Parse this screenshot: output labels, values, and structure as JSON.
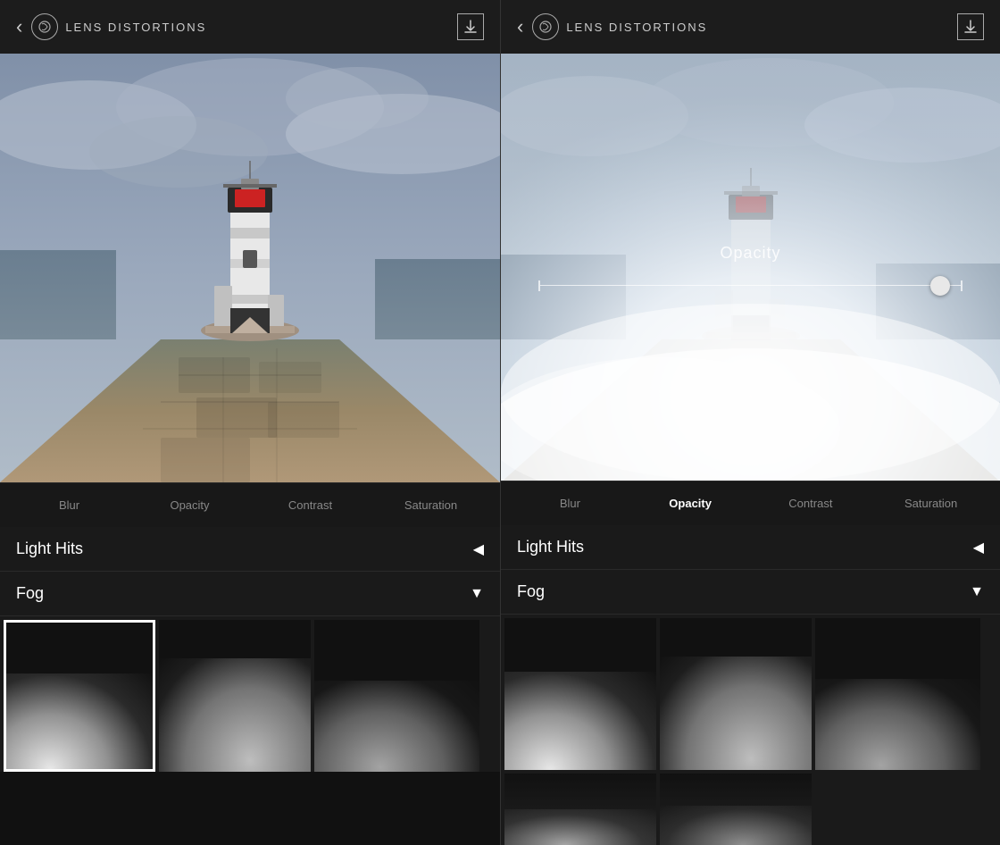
{
  "left_panel": {
    "header": {
      "back_label": "‹",
      "logo_icon": "◎",
      "logo_text": "LENS DISTORTIONS",
      "download_icon": "⬇"
    },
    "controls": [
      {
        "label": "Blur",
        "active": false
      },
      {
        "label": "Opacity",
        "active": false
      },
      {
        "label": "Contrast",
        "active": false
      },
      {
        "label": "Saturation",
        "active": false
      }
    ],
    "sections": [
      {
        "title": "Light Hits",
        "arrow": "◀",
        "type": "collapse"
      },
      {
        "title": "Fog",
        "arrow": "▼",
        "type": "expand"
      }
    ]
  },
  "right_panel": {
    "header": {
      "back_label": "‹",
      "logo_icon": "◎",
      "logo_text": "LENS DISTORTIONS",
      "download_icon": "⬇"
    },
    "opacity_label": "Opacity",
    "controls": [
      {
        "label": "Blur",
        "active": false
      },
      {
        "label": "Opacity",
        "active": true
      },
      {
        "label": "Contrast",
        "active": false
      },
      {
        "label": "Saturation",
        "active": false
      }
    ],
    "sections": [
      {
        "title": "Light Hits",
        "arrow": "◀",
        "type": "collapse"
      },
      {
        "title": "Fog",
        "arrow": "▼",
        "type": "expand"
      }
    ]
  }
}
